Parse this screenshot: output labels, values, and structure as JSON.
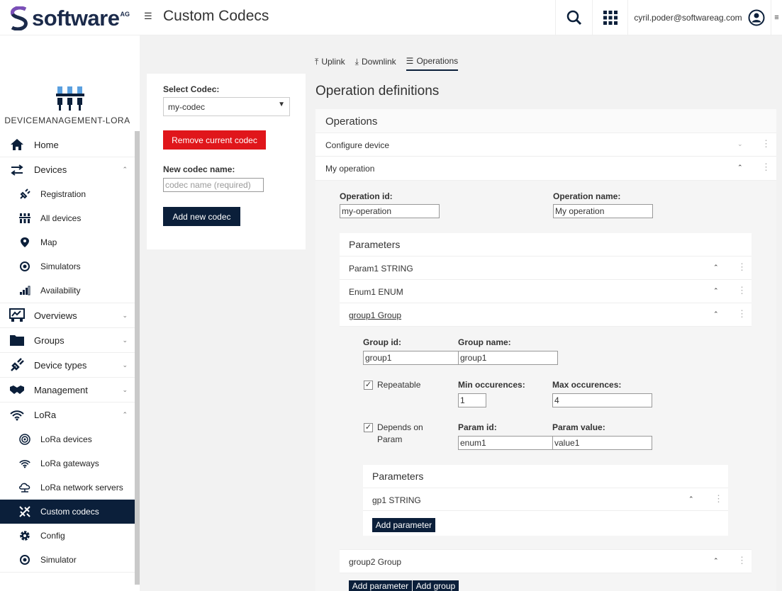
{
  "header": {
    "brand": "software",
    "brand_suffix": "AG",
    "title": "Custom Codecs",
    "user_email": "cyril.poder@softwareag.com"
  },
  "sidebar": {
    "app_name": "DEVICEMANAGEMENT-LORA",
    "items": [
      {
        "label": "Home",
        "icon": "home-icon"
      },
      {
        "label": "Devices",
        "icon": "arrows-icon"
      },
      {
        "label": "Registration",
        "icon": "plug-icon"
      },
      {
        "label": "All devices",
        "icon": "devices-icon"
      },
      {
        "label": "Map",
        "icon": "map-pin-icon"
      },
      {
        "label": "Simulators",
        "icon": "simulator-icon"
      },
      {
        "label": "Availability",
        "icon": "availability-icon"
      },
      {
        "label": "Overviews",
        "icon": "overview-icon"
      },
      {
        "label": "Groups",
        "icon": "folder-icon"
      },
      {
        "label": "Device types",
        "icon": "device-types-icon"
      },
      {
        "label": "Management",
        "icon": "handshake-icon"
      },
      {
        "label": "LoRa",
        "icon": "wifi-icon"
      },
      {
        "label": "LoRa devices",
        "icon": "target-icon"
      },
      {
        "label": "LoRa gateways",
        "icon": "wifi-icon"
      },
      {
        "label": "LoRa network servers",
        "icon": "cloud-icon"
      },
      {
        "label": "Custom codecs",
        "icon": "codec-icon"
      },
      {
        "label": "Config",
        "icon": "gear-icon"
      },
      {
        "label": "Simulator",
        "icon": "simulator-icon"
      }
    ]
  },
  "tabs": [
    {
      "label": "Uplink",
      "icon": "upload-icon"
    },
    {
      "label": "Downlink",
      "icon": "download-icon"
    },
    {
      "label": "Operations",
      "icon": "list-icon"
    }
  ],
  "codec": {
    "select_label": "Select Codec:",
    "selected": "my-codec",
    "remove_label": "Remove current codec",
    "new_name_label": "New codec name:",
    "new_name_placeholder": "codec name (required)",
    "add_label": "Add new codec"
  },
  "operations": {
    "title": "Operation definitions",
    "section_title": "Operations",
    "rows": [
      "Configure device",
      "My operation"
    ],
    "op_id_label": "Operation id:",
    "op_id_value": "my-operation",
    "op_name_label": "Operation name:",
    "op_name_value": "My operation",
    "params_title": "Parameters",
    "params": [
      "Param1 STRING",
      "Enum1 ENUM",
      "group1 Group"
    ],
    "group": {
      "id_label": "Group id:",
      "id_value": "group1",
      "name_label": "Group name:",
      "name_value": "group1",
      "repeatable_label": "Repeatable",
      "min_label": "Min occurences:",
      "min_value": "1",
      "max_label": "Max occurences:",
      "max_value": "4",
      "depends_label_1": "Depends on",
      "depends_label_2": "Param",
      "param_id_label": "Param id:",
      "param_id_value": "enum1",
      "param_value_label": "Param value:",
      "param_value_value": "value1",
      "inner_params_title": "Parameters",
      "inner_param": "gp1 STRING",
      "add_param_label": "Add parameter"
    },
    "group2": "group2 Group",
    "add_param_label": "Add parameter",
    "add_group_label": "Add group"
  }
}
